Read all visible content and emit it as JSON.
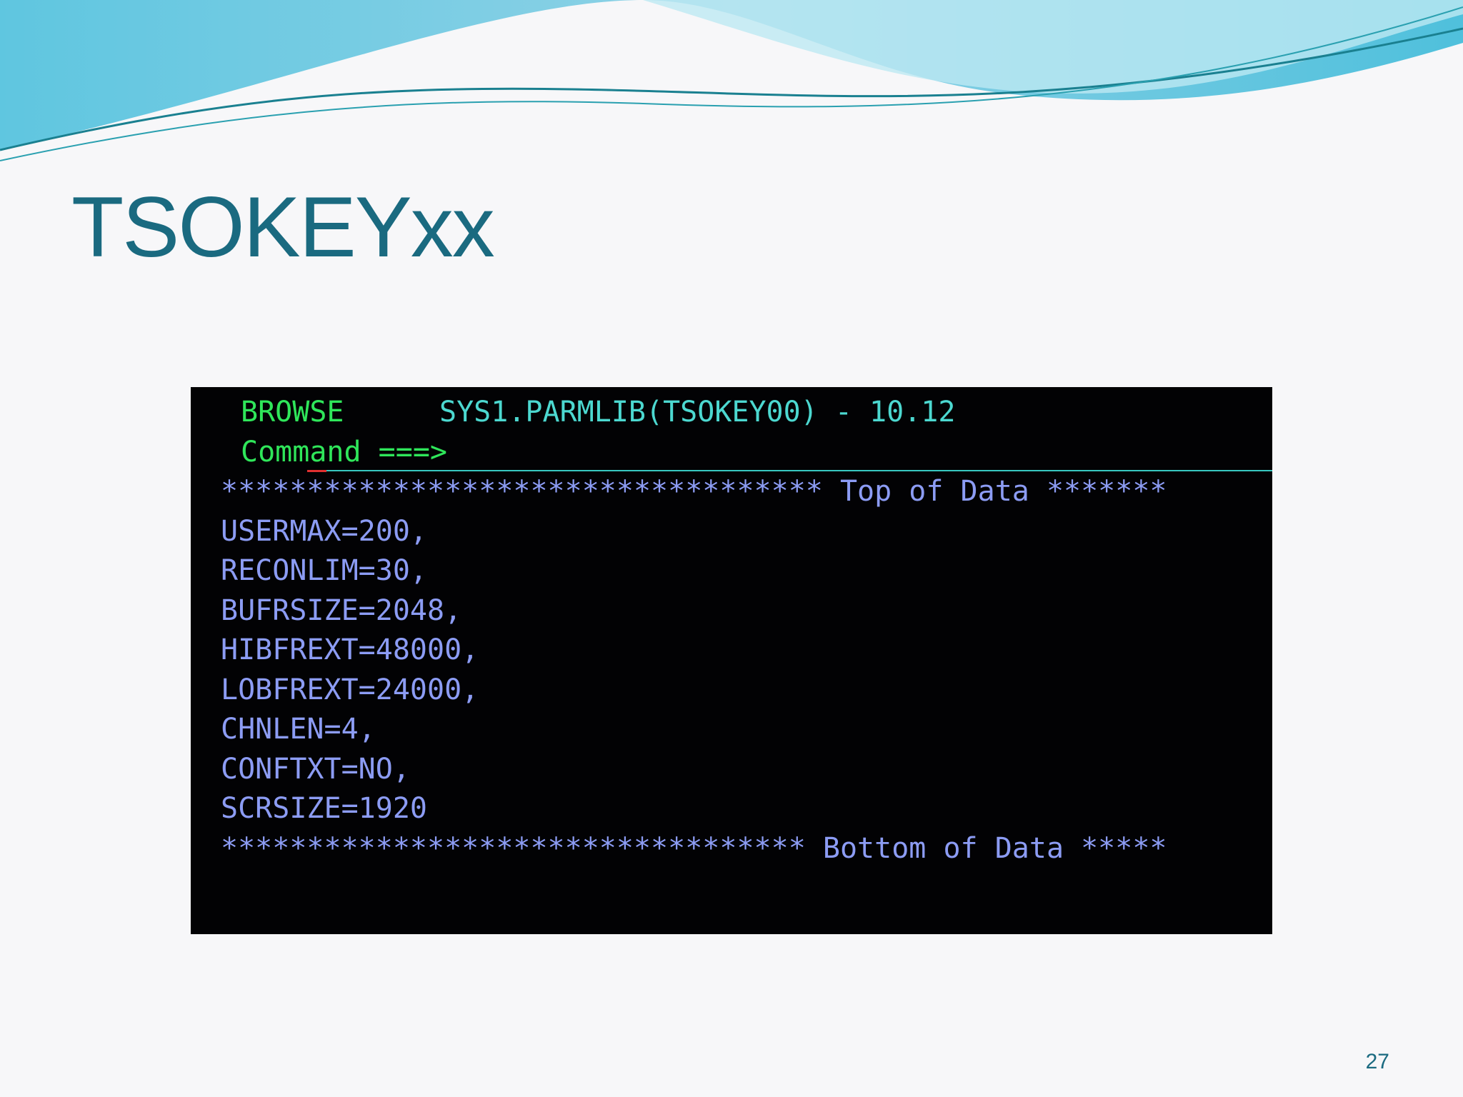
{
  "slide": {
    "title": "TSOKEYxx",
    "page_number": "27"
  },
  "terminal": {
    "panel_label": "BROWSE",
    "dataset": "SYS1.PARMLIB(TSOKEY00) - 10.12",
    "command_label": "Command ===>",
    "top_of_data": "*********************************** Top of Data *******",
    "lines": [
      "USERMAX=200,",
      "RECONLIM=30,",
      "BUFRSIZE=2048,",
      "HIBFREXT=48000,",
      "LOBFREXT=24000,",
      "CHNLEN=4,",
      "CONFTXT=NO,",
      "SCRSIZE=1920"
    ],
    "bottom_of_data": "********************************** Bottom of Data *****"
  },
  "colors": {
    "title": "#1a6a80",
    "terminal_bg": "#020204",
    "green": "#2fe65a",
    "turquoise": "#4cd8d0",
    "blue": "#8c9cf4",
    "cursor": "#e03030"
  }
}
